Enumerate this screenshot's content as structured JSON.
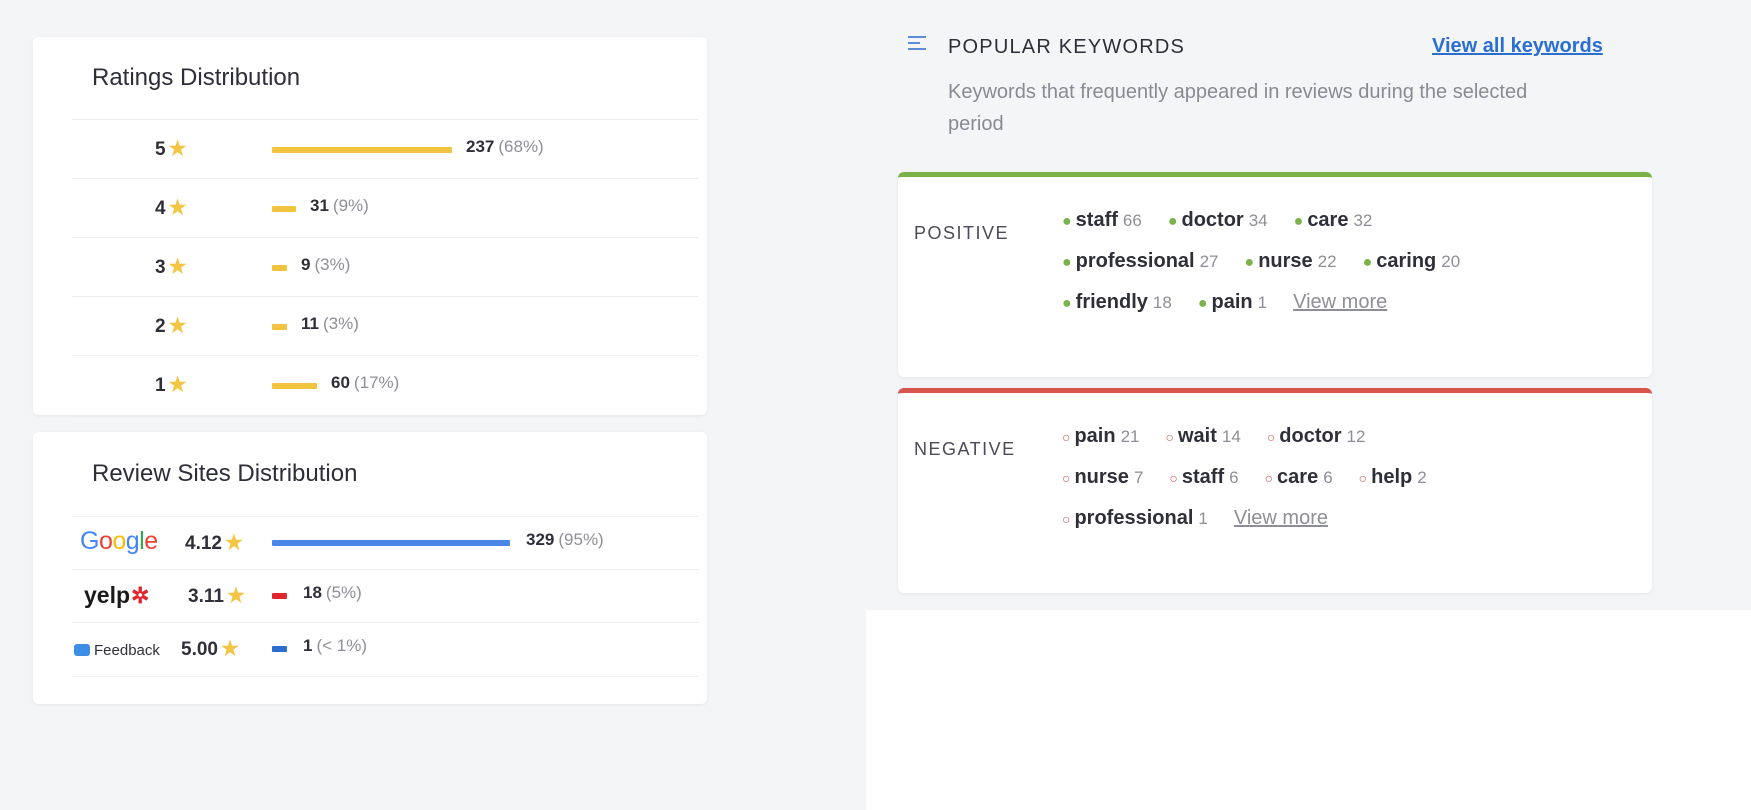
{
  "ratings": {
    "title": "Ratings Distribution",
    "star_color": "#f4c542",
    "bar_color": "#f0c43f",
    "rows": [
      {
        "stars": "5",
        "count": "237",
        "pct": "(68%)",
        "share": 0.68
      },
      {
        "stars": "4",
        "count": "31",
        "pct": "(9%)",
        "share": 0.09
      },
      {
        "stars": "3",
        "count": "9",
        "pct": "(3%)",
        "share": 0.03
      },
      {
        "stars": "2",
        "count": "11",
        "pct": "(3%)",
        "share": 0.03
      },
      {
        "stars": "1",
        "count": "60",
        "pct": "(17%)",
        "share": 0.17
      }
    ]
  },
  "sites": {
    "title": "Review Sites Distribution",
    "rows": [
      {
        "site": "Google",
        "rating": "4.12",
        "count": "329",
        "pct": "(95%)",
        "share": 0.95,
        "bar_color": "#4a86e8"
      },
      {
        "site": "yelp",
        "rating": "3.11",
        "count": "18",
        "pct": "(5%)",
        "share": 0.05,
        "bar_color": "#e0262c"
      },
      {
        "site": "Feedback",
        "rating": "5.00",
        "count": "1",
        "pct": "(< 1%)",
        "share": 0.01,
        "bar_color": "#2b6ed2"
      }
    ]
  },
  "keywords": {
    "title": "POPULAR KEYWORDS",
    "view_all": "View all keywords",
    "subtitle": "Keywords that frequently appeared in reviews during the selected period",
    "icon": "list-icon",
    "positive": {
      "label": "POSITIVE",
      "color": "#7bb34a",
      "lines": [
        [
          {
            "kw": "staff",
            "n": "66"
          },
          {
            "kw": "doctor",
            "n": "34"
          },
          {
            "kw": "care",
            "n": "32"
          }
        ],
        [
          {
            "kw": "professional",
            "n": "27"
          },
          {
            "kw": "nurse",
            "n": "22"
          },
          {
            "kw": "caring",
            "n": "20"
          }
        ],
        [
          {
            "kw": "friendly",
            "n": "18"
          },
          {
            "kw": "pain",
            "n": "1"
          }
        ]
      ],
      "view_more": "View more"
    },
    "negative": {
      "label": "NEGATIVE",
      "color": "#d9534f",
      "lines": [
        [
          {
            "kw": "pain",
            "n": "21"
          },
          {
            "kw": "wait",
            "n": "14"
          },
          {
            "kw": "doctor",
            "n": "12"
          }
        ],
        [
          {
            "kw": "nurse",
            "n": "7"
          },
          {
            "kw": "staff",
            "n": "6"
          },
          {
            "kw": "care",
            "n": "6"
          },
          {
            "kw": "help",
            "n": "2"
          }
        ],
        [
          {
            "kw": "professional",
            "n": "1"
          }
        ]
      ],
      "view_more": "View more"
    }
  }
}
